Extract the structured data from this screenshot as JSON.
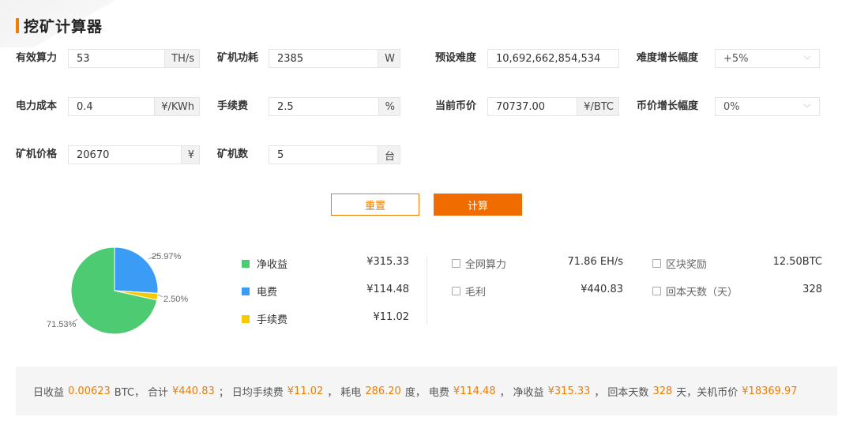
{
  "title": "挖矿计算器",
  "form": {
    "hashrate": {
      "label": "有效算力",
      "value": "53",
      "unit": "TH/s"
    },
    "power": {
      "label": "矿机功耗",
      "value": "2385",
      "unit": "W"
    },
    "difficulty": {
      "label": "预设难度",
      "value": "10,692,662,854,534"
    },
    "difficulty_growth": {
      "label": "难度增长幅度",
      "value": "+5%"
    },
    "electricity": {
      "label": "电力成本",
      "value": "0.4",
      "unit": "¥/KWh"
    },
    "fee": {
      "label": "手续费",
      "value": "2.5",
      "unit": "%"
    },
    "price": {
      "label": "当前币价",
      "value": "70737.00",
      "unit": "¥/BTC"
    },
    "price_growth": {
      "label": "币价增长幅度",
      "value": "0%"
    },
    "miner_price": {
      "label": "矿机价格",
      "value": "20670",
      "unit": "¥"
    },
    "miner_count": {
      "label": "矿机数",
      "value": "5",
      "unit": "台"
    }
  },
  "buttons": {
    "reset": "重置",
    "calculate": "计算"
  },
  "pie": {
    "labels": {
      "net": "71.53%",
      "electric": "25.97%",
      "fee": "2.50%"
    },
    "fractions": {
      "net": 0.7153,
      "electric": 0.2597,
      "fee": 0.025
    }
  },
  "legend": [
    {
      "label": "净收益",
      "value": "¥315.33",
      "color": "#4ccb72"
    },
    {
      "label": "电费",
      "value": "¥114.48",
      "color": "#3a9cf5"
    },
    {
      "label": "手续费",
      "value": "¥11.02",
      "color": "#f7c900"
    }
  ],
  "stats": {
    "network_hashrate": {
      "label": "全网算力",
      "value": "71.86 EH/s",
      "icon": "chart-icon"
    },
    "block_reward": {
      "label": "区块奖励",
      "value": "12.50BTC",
      "icon": "house-icon"
    },
    "gross_profit": {
      "label": "毛利",
      "value": "¥440.83",
      "icon": "wallet-icon"
    },
    "payback_days": {
      "label": "回本天数（天）",
      "value": "328",
      "icon": "calendar-icon"
    }
  },
  "summary": {
    "daily_income_label": "日收益",
    "daily_income": "0.00623",
    "btc_unit": "BTC，",
    "total_label": "合计",
    "total": "¥440.83",
    "sep1": "；",
    "daily_fee_label": "日均手续费",
    "daily_fee": "¥11.02",
    "comma1": "，",
    "power_label": "耗电",
    "power": "286.20",
    "power_unit": "度，",
    "electric_label": "电费",
    "electric": "¥114.48",
    "comma2": "，",
    "net_label": "净收益",
    "net": "¥315.33",
    "comma3": "，",
    "payback_label": "回本天数",
    "payback": "328",
    "payback_unit": "天，关机币价",
    "shutdown_price": "¥18369.97"
  },
  "colors": {
    "accent": "#f07c00",
    "net": "#4ccb72",
    "electric": "#3a9cf5",
    "fee": "#f7c900"
  }
}
